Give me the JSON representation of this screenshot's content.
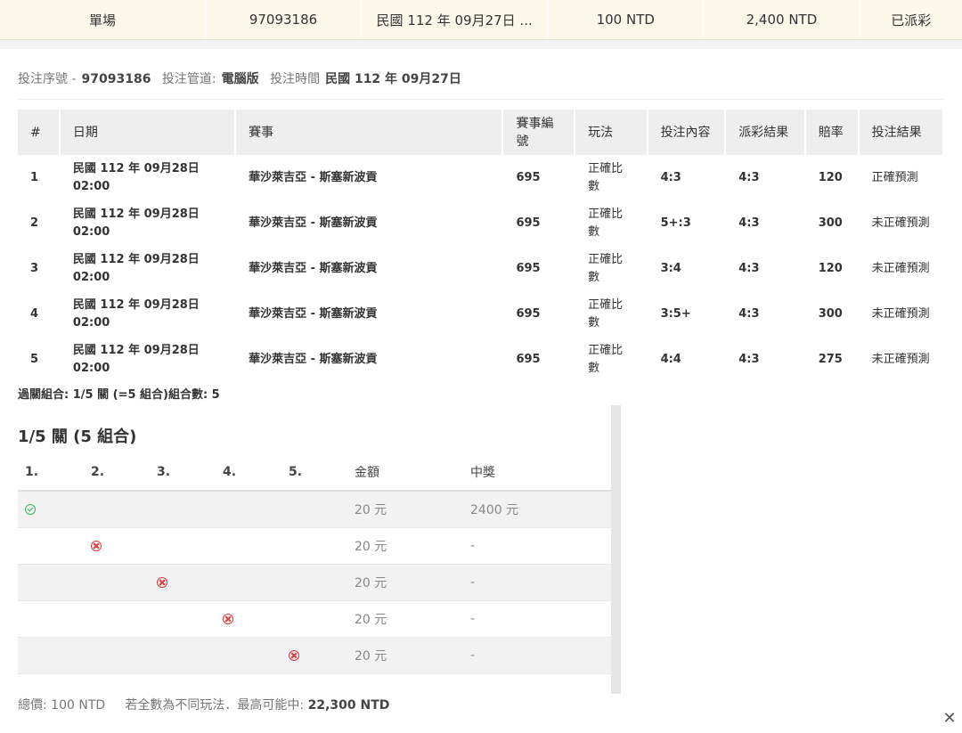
{
  "summary": {
    "type": "單場",
    "bet_id": "97093186",
    "date": "民國 112 年 09月27日 ...",
    "stake": "100 NTD",
    "payout": "2,400 NTD",
    "status": "已派彩"
  },
  "info": {
    "serial_label": "投注序號 -",
    "serial_value": "97093186",
    "channel_label": "投注管道:",
    "channel_value": "電腦版",
    "time_label": "投注時間",
    "time_value": "民國 112 年 09月27日"
  },
  "bets_table": {
    "headers": [
      "#",
      "日期",
      "賽事",
      "賽事編號",
      "玩法",
      "投注內容",
      "派彩結果",
      "賠率",
      "投注結果"
    ],
    "rows": [
      {
        "no": "1",
        "date": "民國 112 年 09月28日",
        "time": "02:00",
        "event": "華沙萊吉亞 - 斯塞新波貢",
        "event_no": "695",
        "play": "正確比數",
        "pick": "4:3",
        "result": "4:3",
        "odds": "120",
        "outcome": "正確預測"
      },
      {
        "no": "2",
        "date": "民國 112 年 09月28日",
        "time": "02:00",
        "event": "華沙萊吉亞 - 斯塞新波貢",
        "event_no": "695",
        "play": "正確比數",
        "pick": "5+:3",
        "result": "4:3",
        "odds": "300",
        "outcome": "未正確預測"
      },
      {
        "no": "3",
        "date": "民國 112 年 09月28日",
        "time": "02:00",
        "event": "華沙萊吉亞 - 斯塞新波貢",
        "event_no": "695",
        "play": "正確比數",
        "pick": "3:4",
        "result": "4:3",
        "odds": "120",
        "outcome": "未正確預測"
      },
      {
        "no": "4",
        "date": "民國 112 年 09月28日",
        "time": "02:00",
        "event": "華沙萊吉亞 - 斯塞新波貢",
        "event_no": "695",
        "play": "正確比數",
        "pick": "3:5+",
        "result": "4:3",
        "odds": "300",
        "outcome": "未正確預測"
      },
      {
        "no": "5",
        "date": "民國 112 年 09月28日",
        "time": "02:00",
        "event": "華沙萊吉亞 - 斯塞新波貢",
        "event_no": "695",
        "play": "正確比數",
        "pick": "4:4",
        "result": "4:3",
        "odds": "275",
        "outcome": "未正確預測"
      }
    ]
  },
  "combo_note": "過關組合: 1/5 關 (=5 組合)組合數: 5",
  "combo_section": {
    "title": "1/5 關 (5 組合)",
    "headers": [
      "1.",
      "2.",
      "3.",
      "4.",
      "5.",
      "金額",
      "中獎"
    ],
    "rows": [
      {
        "col": 1,
        "icon": "check-circle-icon",
        "amount": "20 元",
        "prize": "2400 元"
      },
      {
        "col": 2,
        "icon": "x-circle-icon",
        "amount": "20 元",
        "prize": "-"
      },
      {
        "col": 3,
        "icon": "x-circle-icon",
        "amount": "20 元",
        "prize": "-"
      },
      {
        "col": 4,
        "icon": "x-circle-icon",
        "amount": "20 元",
        "prize": "-"
      },
      {
        "col": 5,
        "icon": "x-circle-icon",
        "amount": "20 元",
        "prize": "-"
      }
    ]
  },
  "footer": {
    "total_label": "總價:",
    "total_value": "100 NTD",
    "max_label": "若全數為不同玩法．最高可能中:",
    "max_value": "22,300 NTD"
  },
  "close_label": "✕",
  "colors": {
    "summary_bg": "#fbf8ea",
    "win_green": "#3bb36b",
    "lose_red": "#e0393e"
  }
}
